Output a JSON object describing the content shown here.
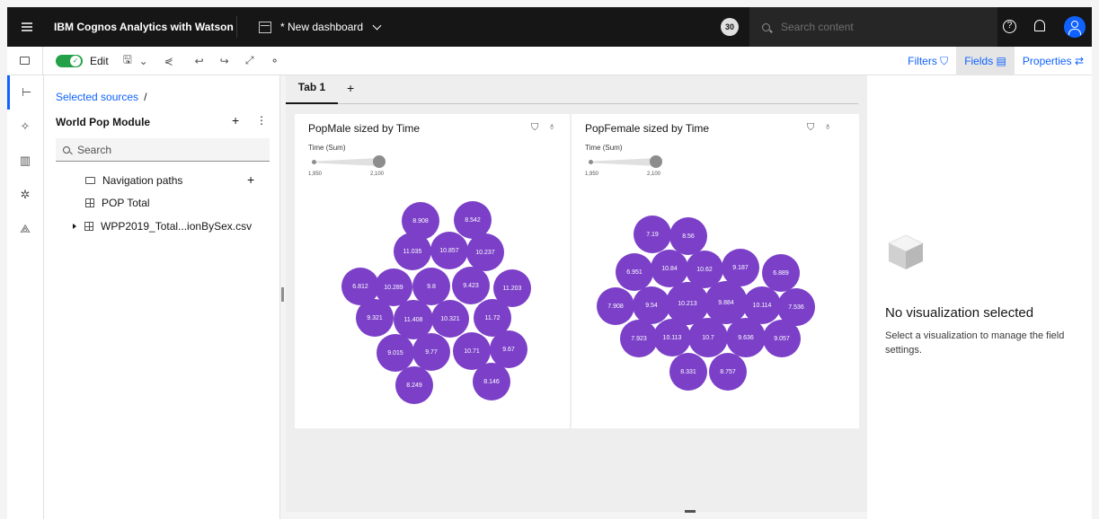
{
  "topbar": {
    "app_title": "IBM Cognos Analytics with Watson",
    "dashboard_title": "* New dashboard",
    "badge": "30",
    "search_placeholder": "Search content"
  },
  "toolbar": {
    "edit_label": "Edit",
    "filters_label": "Filters",
    "fields_label": "Fields",
    "properties_label": "Properties"
  },
  "sources": {
    "breadcrumb": "Selected sources",
    "module_name": "World Pop Module",
    "search_placeholder": "Search",
    "items": [
      {
        "label": "Navigation paths"
      },
      {
        "label": "POP Total"
      },
      {
        "label": "WPP2019_Total...ionBySex.csv"
      }
    ]
  },
  "tabs": {
    "active": "Tab 1",
    "add": "+"
  },
  "widgets": [
    {
      "title": "PopMale sized by Time",
      "legend_label": "Time (Sum)",
      "min_tick": "1,950",
      "max_tick": "2,100",
      "bubbles": [
        "8.908",
        "8.542",
        "11.035",
        "10.857",
        "10.237",
        "6.812",
        "10.289",
        "9.8",
        "9.423",
        "11.203",
        "9.321",
        "11.408",
        "10.321",
        "11.72",
        "9.015",
        "9.77",
        "10.71",
        "9.67",
        "8.249",
        "8.146"
      ]
    },
    {
      "title": "PopFemale sized by Time",
      "legend_label": "Time (Sum)",
      "min_tick": "1,950",
      "max_tick": "2,100",
      "bubbles": [
        "7.19",
        "8.56",
        "6.951",
        "10.84",
        "10.62",
        "9.187",
        "6.889",
        "7.908",
        "9.54",
        "10.213",
        "9.884",
        "10.114",
        "7.536",
        "7.923",
        "10.113",
        "10.7",
        "9.636",
        "9.057",
        "8.331",
        "8.757"
      ]
    }
  ],
  "properties": {
    "empty_title": "No visualization selected",
    "empty_desc": "Select a visualization to manage the field settings."
  },
  "colors": {
    "bubble": "#7b3fc8",
    "accent": "#0f62fe",
    "toggle": "#24a148"
  }
}
